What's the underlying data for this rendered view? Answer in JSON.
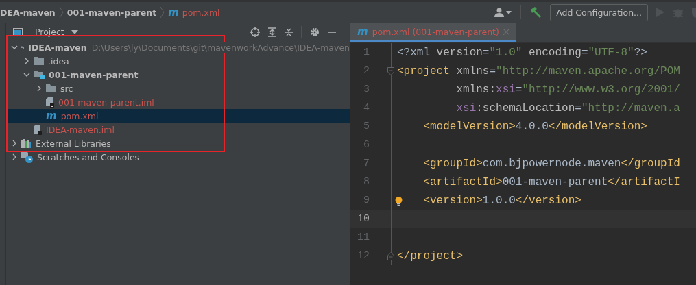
{
  "breadcrumbs": [
    {
      "kind": "folder",
      "text": "DEA-maven"
    },
    {
      "kind": "folder",
      "text": "001-maven-parent"
    },
    {
      "kind": "maven",
      "glyph": "m",
      "text": "pom.xml",
      "unversioned": true
    }
  ],
  "toolbar": {
    "add_configuration": "Add Configuration...",
    "run_disabled": true
  },
  "project_panel": {
    "title": "Project"
  },
  "tree": [
    {
      "name": "IDEA-maven",
      "kind": "module",
      "bold": true,
      "path": "D:\\Users\\ly\\Documents\\git\\mavenworkAdvance\\IDEA-maven",
      "expanded": true,
      "selected": false,
      "unversioned": false,
      "children": [
        {
          "name": ".idea",
          "kind": "folder",
          "bold": false,
          "expanded": false,
          "selected": false,
          "unversioned": false
        },
        {
          "name": "001-maven-parent",
          "kind": "module",
          "bold": true,
          "expanded": true,
          "selected": false,
          "unversioned": false,
          "children": [
            {
              "name": "src",
              "kind": "folder",
              "bold": false,
              "expanded": false,
              "selected": false,
              "unversioned": false
            },
            {
              "name": "001-maven-parent.iml",
              "kind": "iml",
              "bold": false,
              "selected": false,
              "unversioned": true
            },
            {
              "name": "pom.xml",
              "kind": "maven",
              "glyph": "m",
              "bold": false,
              "selected": true,
              "unversioned": true
            }
          ]
        },
        {
          "name": "IDEA-maven.iml",
          "kind": "iml",
          "bold": false,
          "selected": false,
          "unversioned": true
        }
      ]
    },
    {
      "name": "External Libraries",
      "kind": "libraries",
      "bold": false,
      "expanded": false,
      "selected": false,
      "unversioned": false
    },
    {
      "name": "Scratches and Consoles",
      "kind": "scratches",
      "bold": false,
      "expanded": false,
      "selected": false,
      "unversioned": false
    }
  ],
  "editor_tabs": [
    {
      "label": "pom.xml (001-maven-parent)",
      "glyph": "m",
      "selected": true,
      "unversioned": true
    }
  ],
  "code_lines": [
    {
      "number": "1",
      "current": false,
      "segments": [
        {
          "kind": "text",
          "t": "<?xml"
        },
        {
          "kind": "attr",
          "t": " version"
        },
        {
          "kind": "text",
          "t": "="
        },
        {
          "kind": "str",
          "t": "\"1.0\""
        },
        {
          "kind": "attr",
          "t": " encoding"
        },
        {
          "kind": "text",
          "t": "="
        },
        {
          "kind": "str",
          "t": "\"UTF-8\""
        },
        {
          "kind": "text",
          "t": "?>"
        }
      ]
    },
    {
      "number": "2",
      "current": false,
      "marker": {
        "kind": "fold-start"
      },
      "segments": [
        {
          "kind": "tag",
          "t": "<project"
        },
        {
          "kind": "attr",
          "t": " xmlns"
        },
        {
          "kind": "text",
          "t": "="
        },
        {
          "kind": "str",
          "t": "\"http://maven.apache.org/POM"
        }
      ]
    },
    {
      "number": "3",
      "current": false,
      "segments": [
        {
          "kind": "attr",
          "t": "         xmlns:"
        },
        {
          "kind": "ns",
          "t": "xsi"
        },
        {
          "kind": "text",
          "t": "="
        },
        {
          "kind": "str",
          "t": "\"http://www.w3.org/2001/"
        }
      ]
    },
    {
      "number": "4",
      "current": false,
      "segments": [
        {
          "kind": "ns",
          "t": "         xsi"
        },
        {
          "kind": "attr",
          "t": ":schemaLocation"
        },
        {
          "kind": "text",
          "t": "="
        },
        {
          "kind": "str",
          "t": "\"http://maven.a"
        }
      ]
    },
    {
      "number": "5",
      "current": false,
      "segments": [
        {
          "kind": "tag",
          "t": "    <modelVersion>"
        },
        {
          "kind": "text",
          "t": "4.0.0"
        },
        {
          "kind": "tag",
          "t": "</modelVersion>"
        }
      ]
    },
    {
      "number": "6",
      "current": false
    },
    {
      "number": "7",
      "current": false,
      "segments": [
        {
          "kind": "tag",
          "t": "    <groupId>"
        },
        {
          "kind": "text",
          "t": "com.bjpowernode.maven"
        },
        {
          "kind": "tag",
          "t": "</groupId"
        }
      ]
    },
    {
      "number": "8",
      "current": false,
      "segments": [
        {
          "kind": "tag",
          "t": "    <artifactId>"
        },
        {
          "kind": "text",
          "t": "001-maven-parent"
        },
        {
          "kind": "tag",
          "t": "</artifactI"
        }
      ]
    },
    {
      "number": "9",
      "current": false,
      "marker": {
        "kind": "bulb"
      },
      "segments": [
        {
          "kind": "tag",
          "t": "    <version>"
        },
        {
          "kind": "text",
          "t": "1.0.0"
        },
        {
          "kind": "tag",
          "t": "</version>"
        }
      ]
    },
    {
      "number": "10",
      "current": true
    },
    {
      "number": "11",
      "current": false
    },
    {
      "number": "12",
      "current": false,
      "marker": {
        "kind": "fold-end"
      },
      "segments": [
        {
          "kind": "tag",
          "t": "</project>"
        }
      ]
    }
  ]
}
